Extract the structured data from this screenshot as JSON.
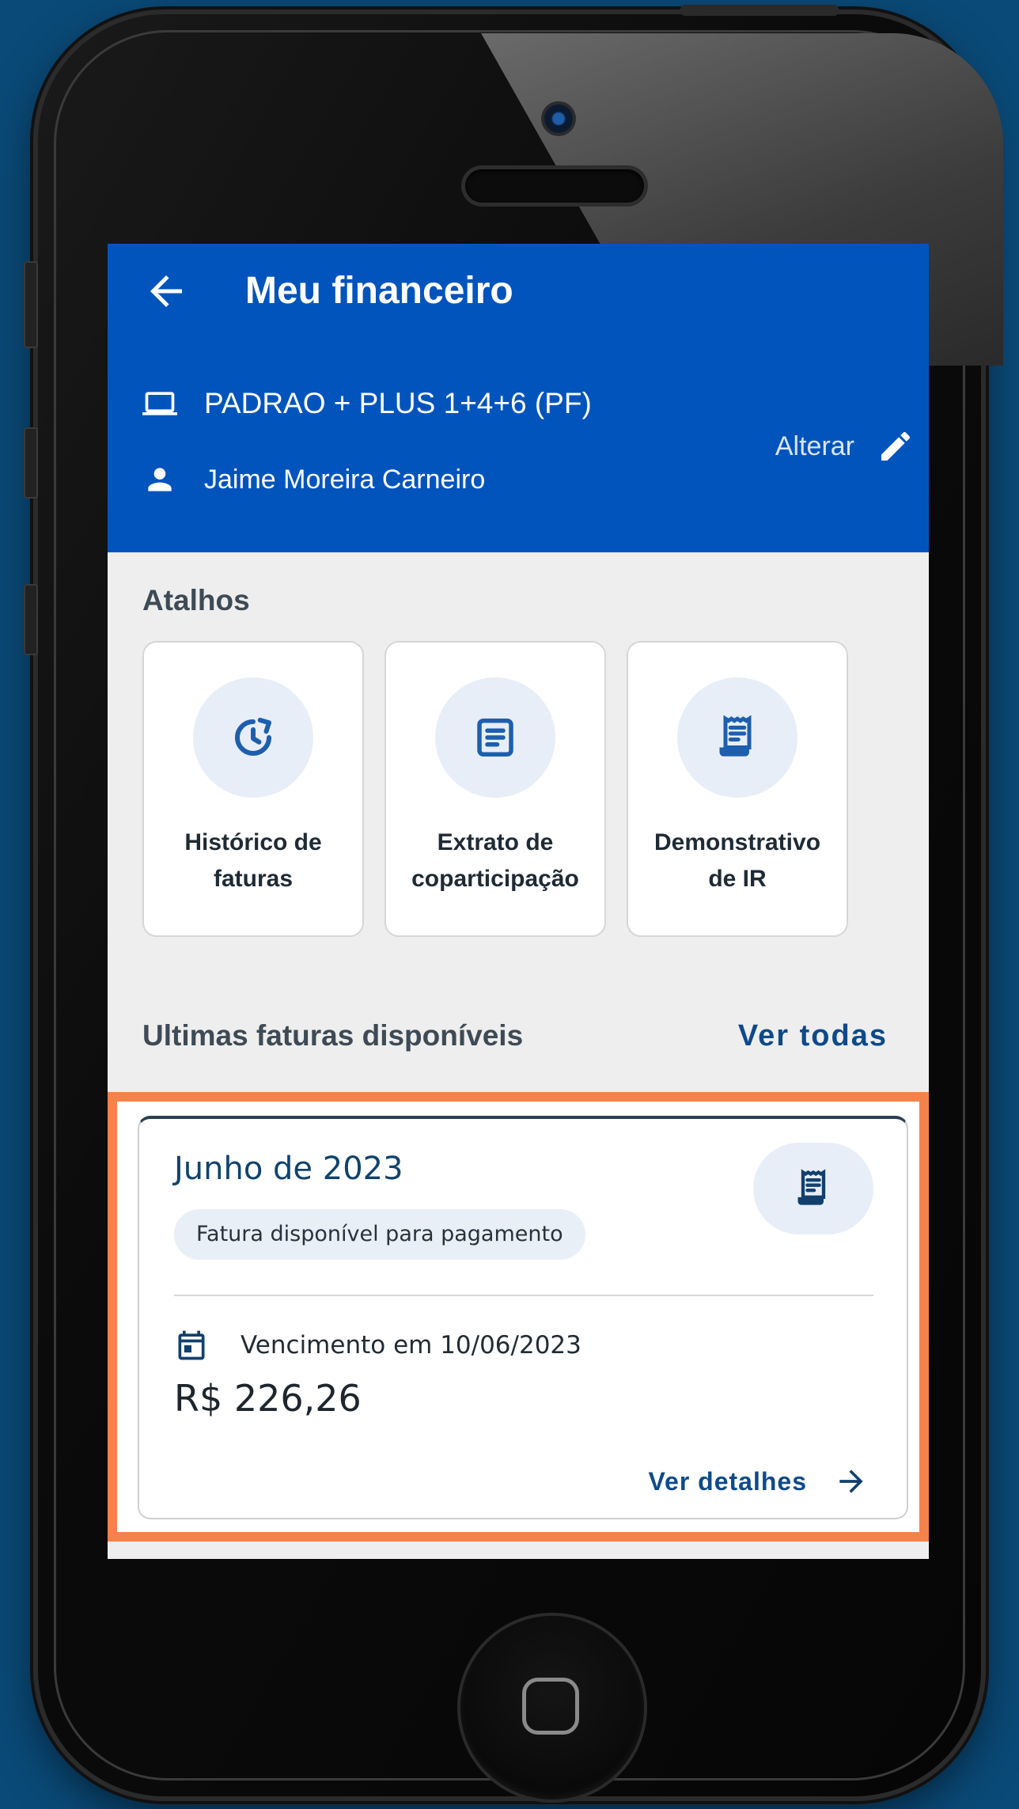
{
  "header": {
    "title": "Meu financeiro",
    "plan": "PADRAO + PLUS 1+4+6 (PF)",
    "user": "Jaime Moreira Carneiro",
    "change_label": "Alterar"
  },
  "shortcuts": {
    "title": "Atalhos",
    "items": [
      {
        "label": "Histórico de\nfaturas",
        "icon": "history-icon"
      },
      {
        "label": "Extrato de\ncoparticipação",
        "icon": "statement-icon"
      },
      {
        "label": "Demonstrativo\nde IR",
        "icon": "receipt-icon"
      }
    ]
  },
  "invoices": {
    "title": "Ultimas faturas disponíveis",
    "see_all": "Ver todas",
    "card": {
      "month": "Junho de 2023",
      "status": "Fatura disponível para pagamento",
      "due": "Vencimento em 10/06/2023",
      "amount": "R$ 226,26",
      "details_label": "Ver detalhes"
    }
  },
  "colors": {
    "appbar": "#0254bd",
    "accent": "#0d4a8a",
    "highlight": "#f4824a",
    "background": "#0a4a78"
  }
}
